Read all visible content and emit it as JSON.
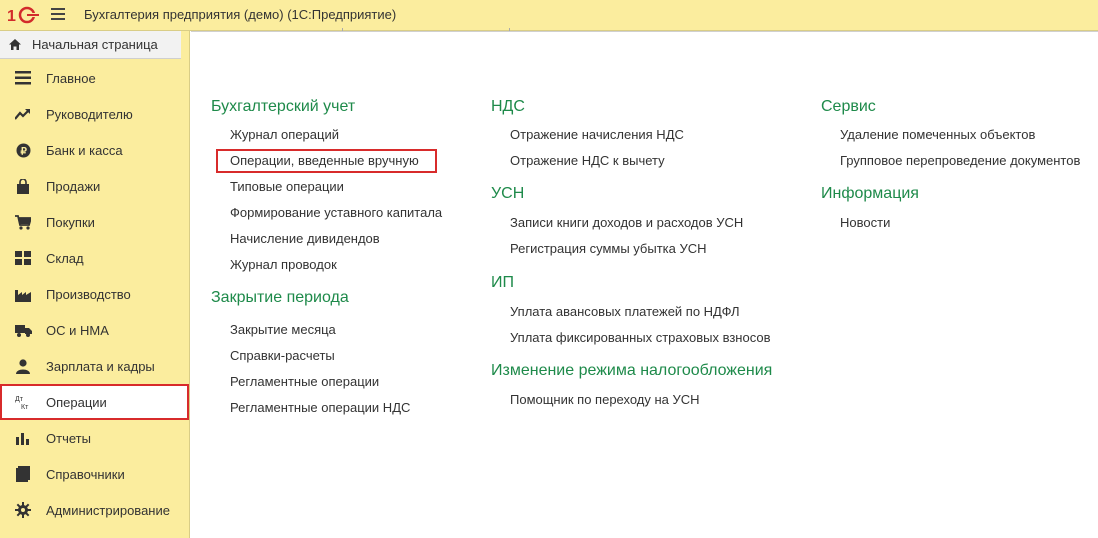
{
  "app": {
    "title": "Бухгалтерия предприятия (демо)  (1С:Предприятие)"
  },
  "home_tab": {
    "label": "Начальная страница",
    "icon": "home-icon"
  },
  "sidebar": {
    "items": [
      {
        "label": "Главное",
        "icon": "menu-lines-icon"
      },
      {
        "label": "Руководителю",
        "icon": "trend-up-icon"
      },
      {
        "label": "Банк и касса",
        "icon": "ruble-coin-icon"
      },
      {
        "label": "Продажи",
        "icon": "shopping-bag-icon"
      },
      {
        "label": "Покупки",
        "icon": "cart-icon"
      },
      {
        "label": "Склад",
        "icon": "warehouse-grid-icon"
      },
      {
        "label": "Производство",
        "icon": "factory-icon"
      },
      {
        "label": "ОС и НМА",
        "icon": "truck-icon"
      },
      {
        "label": "Зарплата и кадры",
        "icon": "person-icon"
      },
      {
        "label": "Операции",
        "icon": "debit-credit-icon",
        "icon_text_top": "Дт",
        "icon_text_bottom": "Кт",
        "selected": true
      },
      {
        "label": "Отчеты",
        "icon": "bar-chart-icon"
      },
      {
        "label": "Справочники",
        "icon": "book-icon"
      },
      {
        "label": "Администрирование",
        "icon": "gear-icon"
      }
    ]
  },
  "columns": [
    {
      "sections": [
        {
          "title": "Бухгалтерский учет",
          "links": [
            "Журнал операций",
            "Операции, введенные вручную",
            "Типовые операции",
            "Формирование уставного капитала",
            "Начисление дивидендов",
            "Журнал проводок"
          ]
        },
        {
          "title": "Закрытие периода",
          "links": [
            "Закрытие месяца",
            "Справки-расчеты",
            "Регламентные операции",
            "Регламентные операции НДС"
          ]
        }
      ]
    },
    {
      "sections": [
        {
          "title": "НДС",
          "links": [
            "Отражение начисления НДС",
            "Отражение НДС к вычету"
          ]
        },
        {
          "title": "УСН",
          "links": [
            "Записи книги доходов и расходов УСН",
            "Регистрация суммы убытка УСН"
          ]
        },
        {
          "title": "ИП",
          "links": [
            "Уплата авансовых платежей по НДФЛ",
            "Уплата фиксированных страховых взносов"
          ]
        },
        {
          "title": "Изменение режима налогообложения",
          "links": [
            "Помощник по переходу на УСН"
          ]
        }
      ]
    },
    {
      "sections": [
        {
          "title": "Сервис",
          "links": [
            "Удаление помеченных объектов",
            "Групповое перепроведение документов"
          ]
        },
        {
          "title": "Информация",
          "links": [
            "Новости"
          ]
        }
      ]
    }
  ],
  "colors": {
    "accent_yellow": "#fbed9e",
    "section_green": "#1e8a4a",
    "highlight_red": "#d82b2b",
    "logo_red": "#d22b2b"
  }
}
